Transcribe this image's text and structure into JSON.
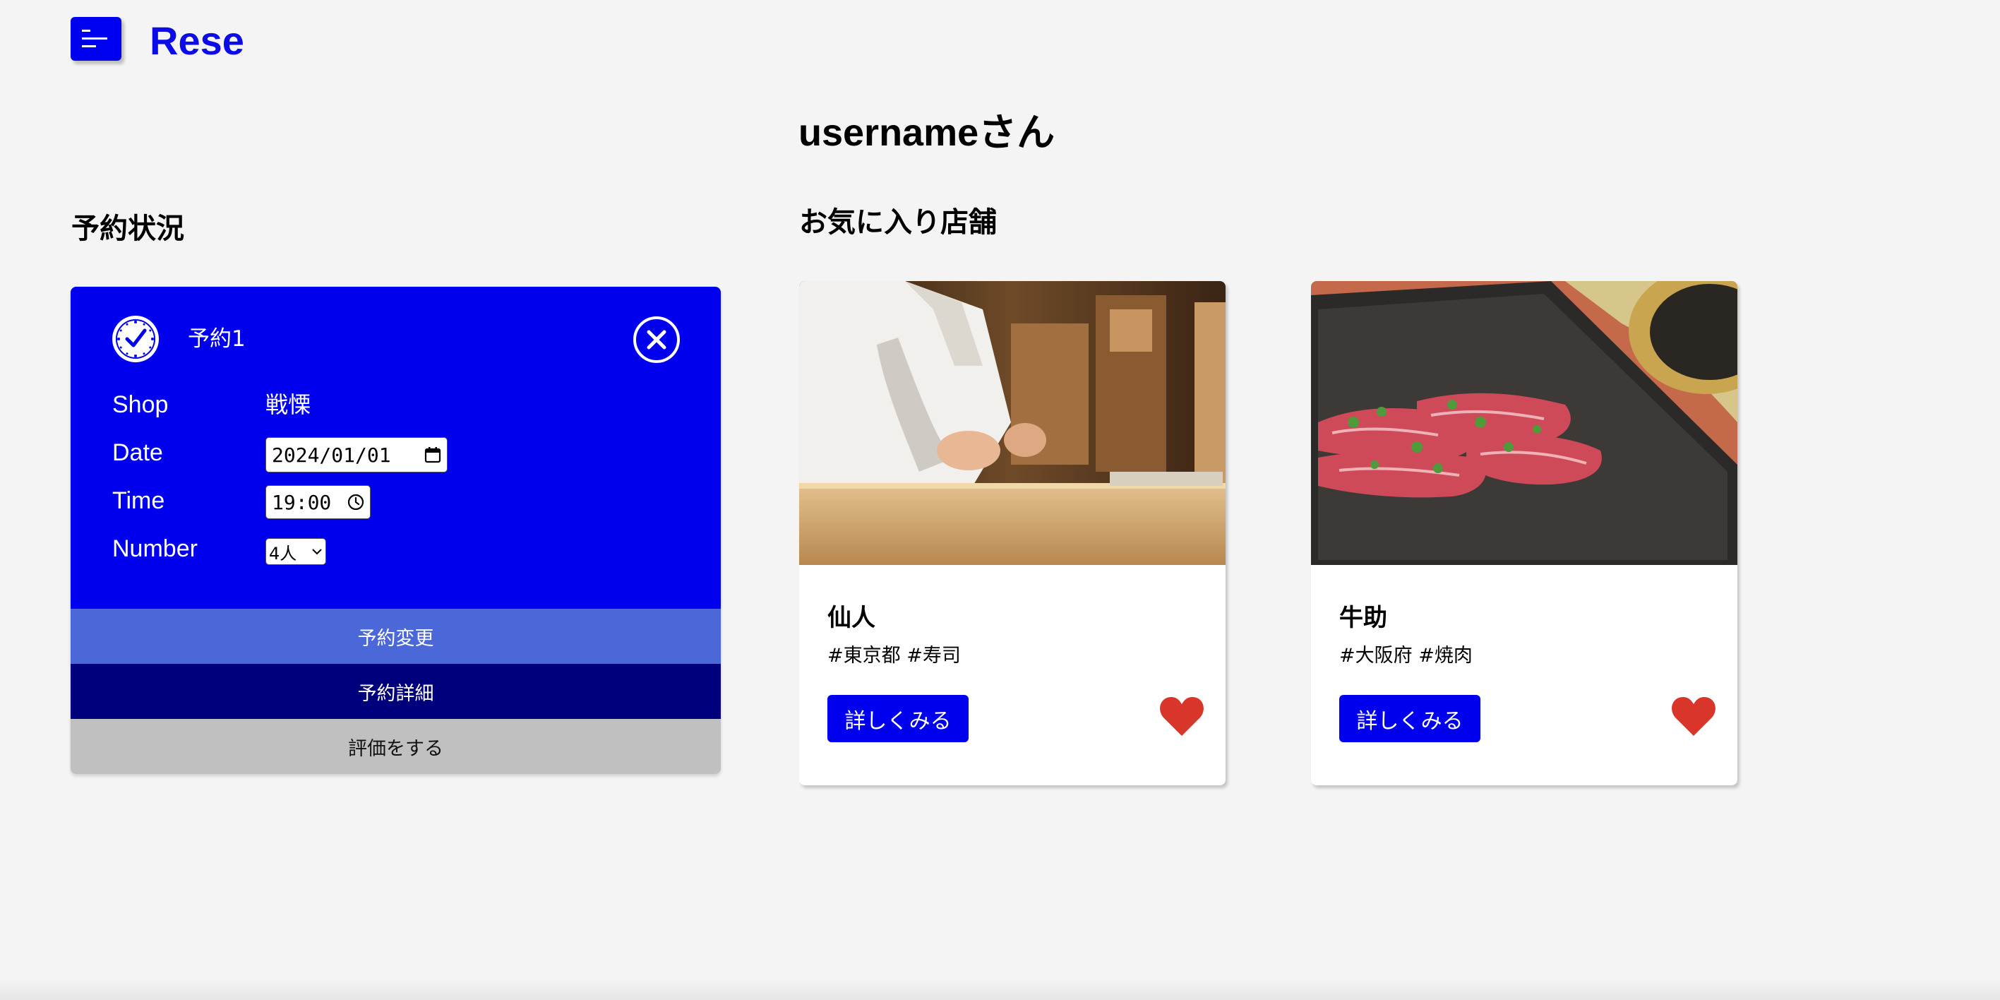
{
  "header": {
    "menu_icon": "menu-icon",
    "logo": "Rese"
  },
  "user": {
    "greeting": "usernameさん"
  },
  "reservations": {
    "section_title": "予約状況",
    "items": [
      {
        "label": "予約1",
        "icons": {
          "status": "clock-check-icon",
          "cancel": "close-circle-icon"
        },
        "fields": {
          "shop_label": "Shop",
          "shop_value": "戦慄",
          "date_label": "Date",
          "date_value": "2024/01/01",
          "time_label": "Time",
          "time_value": "19:00",
          "number_label": "Number",
          "number_value": "4人"
        },
        "actions": {
          "change": "予約変更",
          "detail": "予約詳細",
          "review": "評価をする"
        }
      }
    ]
  },
  "favorites": {
    "section_title": "お気に入り店舗",
    "shops": [
      {
        "name": "仙人",
        "tags": "#東京都 #寿司",
        "detail_button": "詳しくみる",
        "favorite_icon": "heart-icon",
        "favorited": true
      },
      {
        "name": "牛助",
        "tags": "#大阪府 #焼肉",
        "detail_button": "詳しくみる",
        "favorite_icon": "heart-icon",
        "favorited": true
      }
    ]
  },
  "colors": {
    "brand_blue": "#0000ee",
    "logo_blue": "#0b0be8",
    "change_button": "#4a68d8",
    "detail_button_dark": "#00007c",
    "review_button": "#c0c0c0",
    "heart": "#d8362a",
    "background": "#f4f4f4"
  }
}
